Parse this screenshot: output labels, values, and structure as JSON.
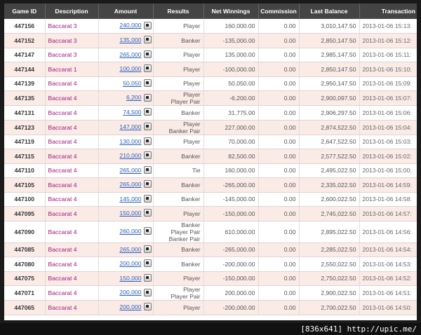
{
  "columns": [
    "Game ID",
    "Description",
    "Amount",
    "Results",
    "Net Winnings",
    "Commission",
    "Last Balance",
    "Transaction Time"
  ],
  "rows": [
    {
      "id": "447156",
      "desc": "Baccarat 3",
      "amount": "240,000",
      "results": [
        "Player"
      ],
      "net": "160,000.00",
      "comm": "0.00",
      "bal": "3,010,147.50",
      "time": "2013-01-06 15:13:"
    },
    {
      "id": "447152",
      "desc": "Baccarat 3",
      "amount": "135,000",
      "results": [
        "Banker"
      ],
      "net": "-135,000.00",
      "comm": "0.00",
      "bal": "2,850,147.50",
      "time": "2013-01-06 15:12:"
    },
    {
      "id": "447147",
      "desc": "Baccarat 3",
      "amount": "265,000",
      "results": [
        "Player"
      ],
      "net": "135,000.00",
      "comm": "0.00",
      "bal": "2,985,147.50",
      "time": "2013-01-06 15:11:"
    },
    {
      "id": "447144",
      "desc": "Baccarat 1",
      "amount": "100,000",
      "results": [
        "Player"
      ],
      "net": "-100,000.00",
      "comm": "0.00",
      "bal": "2,850,147.50",
      "time": "2013-01-06 15:10:"
    },
    {
      "id": "447139",
      "desc": "Baccarat 4",
      "amount": "50,050",
      "results": [
        "Player"
      ],
      "net": "50,050.00",
      "comm": "0.00",
      "bal": "2,950,147.50",
      "time": "2013-01-06 15:09:"
    },
    {
      "id": "447135",
      "desc": "Baccarat 4",
      "amount": "6,200",
      "results": [
        "Player",
        "Player Pair"
      ],
      "net": "-6,200.00",
      "comm": "0.00",
      "bal": "2,900,097.50",
      "time": "2013-01-06 15:07:"
    },
    {
      "id": "447131",
      "desc": "Baccarat 4",
      "amount": "74,500",
      "results": [
        "Banker"
      ],
      "net": "31,775.00",
      "comm": "0.00",
      "bal": "2,906,297.50",
      "time": "2013-01-06 15:06:"
    },
    {
      "id": "447123",
      "desc": "Baccarat 4",
      "amount": "147,000",
      "results": [
        "Player",
        "Banker Pair"
      ],
      "net": "227,000.00",
      "comm": "0.00",
      "bal": "2,874,522.50",
      "time": "2013-01-06 15:04:"
    },
    {
      "id": "447119",
      "desc": "Baccarat 4",
      "amount": "130,000",
      "results": [
        "Player"
      ],
      "net": "70,000.00",
      "comm": "0.00",
      "bal": "2,647,522.50",
      "time": "2013-01-06 15:03:"
    },
    {
      "id": "447115",
      "desc": "Baccarat 4",
      "amount": "210,000",
      "results": [
        "Banker"
      ],
      "net": "82,500.00",
      "comm": "0.00",
      "bal": "2,577,522.50",
      "time": "2013-01-06 15:02:"
    },
    {
      "id": "447110",
      "desc": "Baccarat 4",
      "amount": "265,000",
      "results": [
        "Tie"
      ],
      "net": "160,000.00",
      "comm": "0.00",
      "bal": "2,495,022.50",
      "time": "2013-01-06 15:00:"
    },
    {
      "id": "447105",
      "desc": "Baccarat 4",
      "amount": "265,000",
      "results": [
        "Banker"
      ],
      "net": "-265,000.00",
      "comm": "0.00",
      "bal": "2,335,022.50",
      "time": "2013-01-06 14:59:"
    },
    {
      "id": "447100",
      "desc": "Baccarat 4",
      "amount": "145,000",
      "results": [
        "Banker"
      ],
      "net": "-145,000.00",
      "comm": "0.00",
      "bal": "2,600,022.50",
      "time": "2013-01-06 14:58:"
    },
    {
      "id": "447095",
      "desc": "Baccarat 4",
      "amount": "150,000",
      "results": [
        "Player"
      ],
      "net": "-150,000.00",
      "comm": "0.00",
      "bal": "2,745,022.50",
      "time": "2013-01-06 14:57:"
    },
    {
      "id": "447090",
      "desc": "Baccarat 4",
      "amount": "260,000",
      "results": [
        "Banker",
        "Player Pair",
        "Banker Pair"
      ],
      "net": "610,000.00",
      "comm": "0.00",
      "bal": "2,895,022.50",
      "time": "2013-01-06 14:56:"
    },
    {
      "id": "447085",
      "desc": "Baccarat 4",
      "amount": "265,000",
      "results": [
        "Banker"
      ],
      "net": "-265,000.00",
      "comm": "0.00",
      "bal": "2,285,022.50",
      "time": "2013-01-06 14:54:"
    },
    {
      "id": "447080",
      "desc": "Baccarat 4",
      "amount": "200,000",
      "results": [
        "Banker"
      ],
      "net": "-200,000.00",
      "comm": "0.00",
      "bal": "2,550,022.50",
      "time": "2013-01-06 14:53:"
    },
    {
      "id": "447075",
      "desc": "Baccarat 4",
      "amount": "150,000",
      "results": [
        "Player"
      ],
      "net": "-150,000.00",
      "comm": "0.00",
      "bal": "2,750,022.50",
      "time": "2013-01-06 14:52:"
    },
    {
      "id": "447071",
      "desc": "Baccarat 4",
      "amount": "200,000",
      "results": [
        "Player",
        "Player Pair"
      ],
      "net": "200,000.00",
      "comm": "0.00",
      "bal": "2,900,022.50",
      "time": "2013-01-06 14:51:"
    },
    {
      "id": "447065",
      "desc": "Baccarat 4",
      "amount": "200,000",
      "results": [
        "Player"
      ],
      "net": "-200,000.00",
      "comm": "0.00",
      "bal": "2,700,022.50",
      "time": "2013-01-06 14:50:"
    }
  ],
  "credit": "[836x641] http://upic.me/",
  "colors": {
    "header_bg": "#444444",
    "row_alt": "#fbebe7",
    "desc_text": "#a0197b",
    "link": "#2a5fb8"
  },
  "icons": {
    "amount_detail": "camera-icon"
  }
}
